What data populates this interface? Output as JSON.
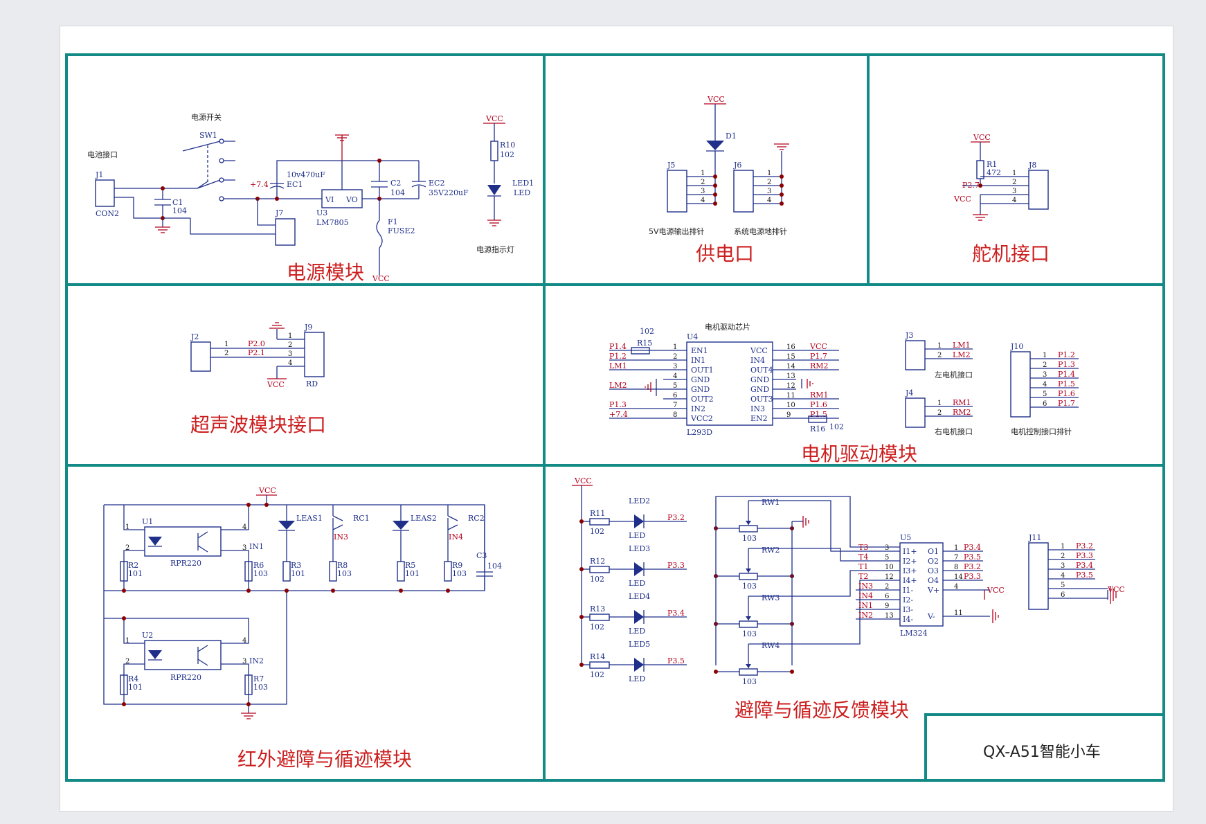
{
  "sections": {
    "power": {
      "title": "电源模块"
    },
    "supply": {
      "title": "供电口"
    },
    "servo": {
      "title": "舵机接口"
    },
    "ultrasonic": {
      "title": "超声波模块接口"
    },
    "motor": {
      "title": "电机驱动模块"
    },
    "ir": {
      "title": "红外避障与循迹模块"
    },
    "feedback": {
      "title": "避障与循迹反馈模块"
    }
  },
  "title_block": {
    "text": "QX-A51智能小车"
  },
  "power": {
    "battery_label": "电池接口",
    "switch_label": "电源开关",
    "sw": "SW1",
    "j1": "J1",
    "con2": "CON2",
    "c1": "C1",
    "c1_val": "104",
    "ec1": "EC1",
    "ec1_val": "10v470uF",
    "u3": "U3",
    "u3_part": "LM7805",
    "vi": "VI",
    "vo": "VO",
    "c2": "C2",
    "c2_val": "104",
    "ec2": "EC2",
    "ec2_val": "35V220uF",
    "j7": "J7",
    "f1": "F1",
    "f1_val": "FUSE2",
    "plus74": "+7.4",
    "vcc": "VCC",
    "r10": "R10",
    "r10_val": "102",
    "led1": "LED1",
    "led": "LED",
    "led_label": "电源指示灯"
  },
  "supply": {
    "vcc": "VCC",
    "d1": "D1",
    "j5": "J5",
    "j6": "J6",
    "j5_label": "5V电源输出排针",
    "j6_label": "系统电源地排针"
  },
  "servo": {
    "vcc": "VCC",
    "r1": "R1",
    "r1_val": "472",
    "j8": "J8",
    "p27": "P2.7",
    "vcc2": "VCC"
  },
  "ultra": {
    "j2": "J2",
    "j9": "J9",
    "rd": "RD",
    "p20": "P2.0",
    "p21": "P2.1",
    "vcc": "VCC"
  },
  "motor": {
    "chip_label": "电机驱动芯片",
    "u4": "U4",
    "part": "L293D",
    "left_pins": [
      "EN1",
      "IN1",
      "OUT1",
      "GND",
      "GND",
      "OUT2",
      "IN2",
      "VCC2"
    ],
    "right_pins": [
      "VCC",
      "IN4",
      "OUT4",
      "GND",
      "GND",
      "OUT3",
      "IN3",
      "EN2"
    ],
    "left_nums": [
      "1",
      "2",
      "3",
      "4",
      "5",
      "6",
      "7",
      "8"
    ],
    "right_nums": [
      "16",
      "15",
      "14",
      "13",
      "12",
      "11",
      "10",
      "9"
    ],
    "left_nets": [
      "P1.4",
      "P1.2",
      "LM1",
      "",
      "LM2",
      "",
      "P1.3",
      "+7.4"
    ],
    "right_nets": [
      "VCC",
      "P1.7",
      "RM2",
      "",
      "",
      "RM1",
      "P1.6",
      "P1.5"
    ],
    "r15": "R15",
    "r15_val": "102",
    "r16": "R16",
    "r16_val": "102",
    "j3": "J3",
    "j4": "J4",
    "j10": "J10",
    "j3_nets": [
      "LM1",
      "LM2"
    ],
    "j4_nets": [
      "RM1",
      "RM2"
    ],
    "j10_nets": [
      "P1.2",
      "P1.3",
      "P1.4",
      "P1.5",
      "P1.6",
      "P1.7"
    ],
    "j3_label": "左电机接口",
    "j4_label": "右电机接口",
    "j10_label": "电机控制接口排针"
  },
  "ir": {
    "vcc": "VCC",
    "u1": "U1",
    "u2": "U2",
    "rpr": "RPR220",
    "r2": "R2",
    "r4": "R4",
    "r6": "R6",
    "r7": "R7",
    "r3": "R3",
    "r8": "R8",
    "r5": "R5",
    "r9": "R9",
    "v101": "101",
    "v103": "103",
    "in1": "IN1",
    "in2": "IN2",
    "in3": "IN3",
    "in4": "IN4",
    "leas1": "LEAS1",
    "leas2": "LEAS2",
    "rc1": "RC1",
    "rc2": "RC2",
    "c3": "C3",
    "c3_val": "104"
  },
  "fb": {
    "vcc": "VCC",
    "resistors": [
      "R11",
      "R12",
      "R13",
      "R14"
    ],
    "r_val": "102",
    "leds": [
      "LED2",
      "LED3",
      "LED4",
      "LED5"
    ],
    "led": "LED",
    "nets": [
      "P3.2",
      "P3.3",
      "P3.4",
      "P3.5"
    ],
    "rws": [
      "RW1",
      "RW2",
      "RW3",
      "RW4"
    ],
    "rw_val": "103",
    "u5": "U5",
    "part": "LM324",
    "in_pins": [
      "I1+",
      "I2+",
      "I3+",
      "I4+",
      "I1-",
      "I2-",
      "I3-",
      "I4-"
    ],
    "out_pins": [
      "O1",
      "O2",
      "O3",
      "O4",
      "V+",
      "V-"
    ],
    "in_nets": [
      "T3",
      "T4",
      "T1",
      "T2",
      "IN3",
      "IN4",
      "IN1",
      "IN2"
    ],
    "in_nums": [
      "3",
      "5",
      "10",
      "12",
      "2",
      "6",
      "9",
      "13"
    ],
    "out_nums": [
      "1",
      "7",
      "8",
      "14",
      "4",
      "11"
    ],
    "out_nets": [
      "P3.4",
      "P3.5",
      "P3.2",
      "P3.3"
    ],
    "vcc_out": "VCC",
    "j11": "J11",
    "j11_nets": [
      "P3.2",
      "P3.3",
      "P3.4",
      "P3.5",
      "",
      ""
    ],
    "j11_vcc": "VCC"
  }
}
